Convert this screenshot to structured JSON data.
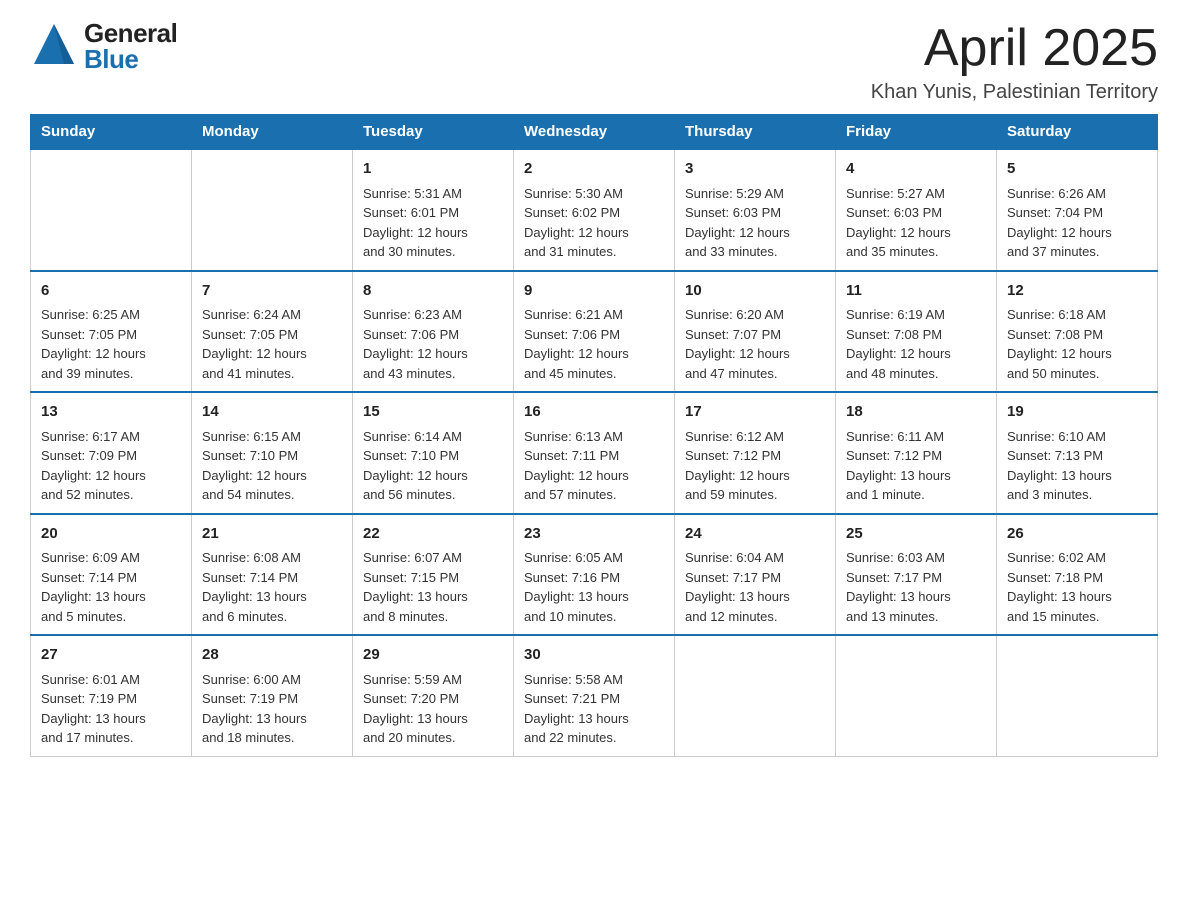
{
  "header": {
    "title": "April 2025",
    "subtitle": "Khan Yunis, Palestinian Territory",
    "logo_general": "General",
    "logo_blue": "Blue"
  },
  "columns": [
    "Sunday",
    "Monday",
    "Tuesday",
    "Wednesday",
    "Thursday",
    "Friday",
    "Saturday"
  ],
  "weeks": [
    [
      {
        "day": "",
        "info": ""
      },
      {
        "day": "",
        "info": ""
      },
      {
        "day": "1",
        "info": "Sunrise: 5:31 AM\nSunset: 6:01 PM\nDaylight: 12 hours\nand 30 minutes."
      },
      {
        "day": "2",
        "info": "Sunrise: 5:30 AM\nSunset: 6:02 PM\nDaylight: 12 hours\nand 31 minutes."
      },
      {
        "day": "3",
        "info": "Sunrise: 5:29 AM\nSunset: 6:03 PM\nDaylight: 12 hours\nand 33 minutes."
      },
      {
        "day": "4",
        "info": "Sunrise: 5:27 AM\nSunset: 6:03 PM\nDaylight: 12 hours\nand 35 minutes."
      },
      {
        "day": "5",
        "info": "Sunrise: 6:26 AM\nSunset: 7:04 PM\nDaylight: 12 hours\nand 37 minutes."
      }
    ],
    [
      {
        "day": "6",
        "info": "Sunrise: 6:25 AM\nSunset: 7:05 PM\nDaylight: 12 hours\nand 39 minutes."
      },
      {
        "day": "7",
        "info": "Sunrise: 6:24 AM\nSunset: 7:05 PM\nDaylight: 12 hours\nand 41 minutes."
      },
      {
        "day": "8",
        "info": "Sunrise: 6:23 AM\nSunset: 7:06 PM\nDaylight: 12 hours\nand 43 minutes."
      },
      {
        "day": "9",
        "info": "Sunrise: 6:21 AM\nSunset: 7:06 PM\nDaylight: 12 hours\nand 45 minutes."
      },
      {
        "day": "10",
        "info": "Sunrise: 6:20 AM\nSunset: 7:07 PM\nDaylight: 12 hours\nand 47 minutes."
      },
      {
        "day": "11",
        "info": "Sunrise: 6:19 AM\nSunset: 7:08 PM\nDaylight: 12 hours\nand 48 minutes."
      },
      {
        "day": "12",
        "info": "Sunrise: 6:18 AM\nSunset: 7:08 PM\nDaylight: 12 hours\nand 50 minutes."
      }
    ],
    [
      {
        "day": "13",
        "info": "Sunrise: 6:17 AM\nSunset: 7:09 PM\nDaylight: 12 hours\nand 52 minutes."
      },
      {
        "day": "14",
        "info": "Sunrise: 6:15 AM\nSunset: 7:10 PM\nDaylight: 12 hours\nand 54 minutes."
      },
      {
        "day": "15",
        "info": "Sunrise: 6:14 AM\nSunset: 7:10 PM\nDaylight: 12 hours\nand 56 minutes."
      },
      {
        "day": "16",
        "info": "Sunrise: 6:13 AM\nSunset: 7:11 PM\nDaylight: 12 hours\nand 57 minutes."
      },
      {
        "day": "17",
        "info": "Sunrise: 6:12 AM\nSunset: 7:12 PM\nDaylight: 12 hours\nand 59 minutes."
      },
      {
        "day": "18",
        "info": "Sunrise: 6:11 AM\nSunset: 7:12 PM\nDaylight: 13 hours\nand 1 minute."
      },
      {
        "day": "19",
        "info": "Sunrise: 6:10 AM\nSunset: 7:13 PM\nDaylight: 13 hours\nand 3 minutes."
      }
    ],
    [
      {
        "day": "20",
        "info": "Sunrise: 6:09 AM\nSunset: 7:14 PM\nDaylight: 13 hours\nand 5 minutes."
      },
      {
        "day": "21",
        "info": "Sunrise: 6:08 AM\nSunset: 7:14 PM\nDaylight: 13 hours\nand 6 minutes."
      },
      {
        "day": "22",
        "info": "Sunrise: 6:07 AM\nSunset: 7:15 PM\nDaylight: 13 hours\nand 8 minutes."
      },
      {
        "day": "23",
        "info": "Sunrise: 6:05 AM\nSunset: 7:16 PM\nDaylight: 13 hours\nand 10 minutes."
      },
      {
        "day": "24",
        "info": "Sunrise: 6:04 AM\nSunset: 7:17 PM\nDaylight: 13 hours\nand 12 minutes."
      },
      {
        "day": "25",
        "info": "Sunrise: 6:03 AM\nSunset: 7:17 PM\nDaylight: 13 hours\nand 13 minutes."
      },
      {
        "day": "26",
        "info": "Sunrise: 6:02 AM\nSunset: 7:18 PM\nDaylight: 13 hours\nand 15 minutes."
      }
    ],
    [
      {
        "day": "27",
        "info": "Sunrise: 6:01 AM\nSunset: 7:19 PM\nDaylight: 13 hours\nand 17 minutes."
      },
      {
        "day": "28",
        "info": "Sunrise: 6:00 AM\nSunset: 7:19 PM\nDaylight: 13 hours\nand 18 minutes."
      },
      {
        "day": "29",
        "info": "Sunrise: 5:59 AM\nSunset: 7:20 PM\nDaylight: 13 hours\nand 20 minutes."
      },
      {
        "day": "30",
        "info": "Sunrise: 5:58 AM\nSunset: 7:21 PM\nDaylight: 13 hours\nand 22 minutes."
      },
      {
        "day": "",
        "info": ""
      },
      {
        "day": "",
        "info": ""
      },
      {
        "day": "",
        "info": ""
      }
    ]
  ]
}
